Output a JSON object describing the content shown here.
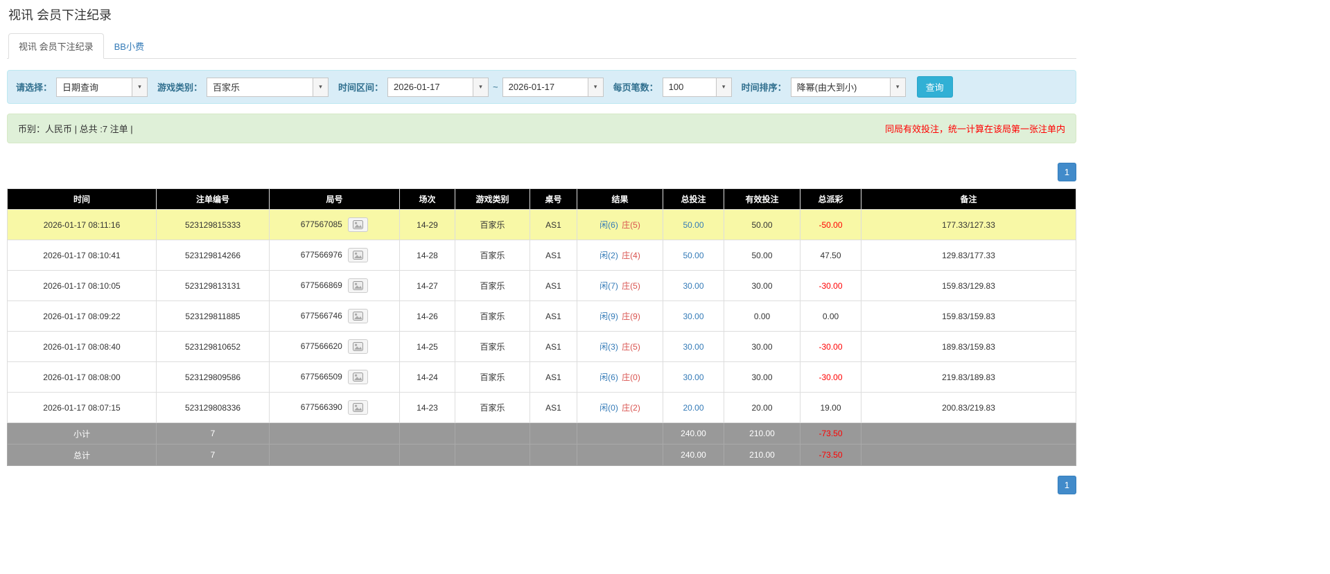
{
  "page": {
    "title": "视讯 会员下注纪录"
  },
  "tabs": [
    {
      "label": "视讯 会员下注纪录"
    },
    {
      "label": "BB小费"
    }
  ],
  "filters": {
    "query_type_label": "请选择：",
    "query_type_value": "日期查询",
    "game_type_label": "游戏类别：",
    "game_type_value": "百家乐",
    "date_range_label": "时间区间：",
    "date_from": "2026-01-17",
    "date_separator": "~",
    "date_to": "2026-01-17",
    "page_size_label": "每页笔数：",
    "page_size_value": "100",
    "sort_label": "时间排序：",
    "sort_value": "降幂(由大到小)",
    "search_button_label": "查询"
  },
  "summary_bar": {
    "info_text": "币别：人民币 | 总共 :7 注单 |",
    "note_text": "同局有效投注，统一计算在该局第一张注单内"
  },
  "pagination": {
    "top_page": "1",
    "bottom_page": "1"
  },
  "table": {
    "headers": [
      "时间",
      "注单编号",
      "局号",
      "场次",
      "游戏类别",
      "桌号",
      "结果",
      "总投注",
      "有效投注",
      "总派彩",
      "备注"
    ],
    "rows": [
      {
        "time": "2026-01-17 08:11:16",
        "bet_id": "523129815333",
        "round_id": "677567085",
        "session": "14-29",
        "game_type": "百家乐",
        "table_no": "AS1",
        "result_player": "闲(6)",
        "result_banker": "庄(5)",
        "total_bet": "50.00",
        "valid_bet": "50.00",
        "payout": "-50.00",
        "note": "177.33/127.33",
        "highlighted": true
      },
      {
        "time": "2026-01-17 08:10:41",
        "bet_id": "523129814266",
        "round_id": "677566976",
        "session": "14-28",
        "game_type": "百家乐",
        "table_no": "AS1",
        "result_player": "闲(2)",
        "result_banker": "庄(4)",
        "total_bet": "50.00",
        "valid_bet": "50.00",
        "payout": "47.50",
        "note": "129.83/177.33",
        "highlighted": false
      },
      {
        "time": "2026-01-17 08:10:05",
        "bet_id": "523129813131",
        "round_id": "677566869",
        "session": "14-27",
        "game_type": "百家乐",
        "table_no": "AS1",
        "result_player": "闲(7)",
        "result_banker": "庄(5)",
        "total_bet": "30.00",
        "valid_bet": "30.00",
        "payout": "-30.00",
        "note": "159.83/129.83",
        "highlighted": false
      },
      {
        "time": "2026-01-17 08:09:22",
        "bet_id": "523129811885",
        "round_id": "677566746",
        "session": "14-26",
        "game_type": "百家乐",
        "table_no": "AS1",
        "result_player": "闲(9)",
        "result_banker": "庄(9)",
        "total_bet": "30.00",
        "valid_bet": "0.00",
        "payout": "0.00",
        "note": "159.83/159.83",
        "highlighted": false
      },
      {
        "time": "2026-01-17 08:08:40",
        "bet_id": "523129810652",
        "round_id": "677566620",
        "session": "14-25",
        "game_type": "百家乐",
        "table_no": "AS1",
        "result_player": "闲(3)",
        "result_banker": "庄(5)",
        "total_bet": "30.00",
        "valid_bet": "30.00",
        "payout": "-30.00",
        "note": "189.83/159.83",
        "highlighted": false
      },
      {
        "time": "2026-01-17 08:08:00",
        "bet_id": "523129809586",
        "round_id": "677566509",
        "session": "14-24",
        "game_type": "百家乐",
        "table_no": "AS1",
        "result_player": "闲(6)",
        "result_banker": "庄(0)",
        "total_bet": "30.00",
        "valid_bet": "30.00",
        "payout": "-30.00",
        "note": "219.83/189.83",
        "highlighted": false
      },
      {
        "time": "2026-01-17 08:07:15",
        "bet_id": "523129808336",
        "round_id": "677566390",
        "session": "14-23",
        "game_type": "百家乐",
        "table_no": "AS1",
        "result_player": "闲(0)",
        "result_banker": "庄(2)",
        "total_bet": "20.00",
        "valid_bet": "20.00",
        "payout": "19.00",
        "note": "200.83/219.83",
        "highlighted": false
      }
    ],
    "subtotal": {
      "label": "小计",
      "count": "7",
      "total_bet": "240.00",
      "valid_bet": "210.00",
      "total_payout": "-73.50"
    },
    "grand_total": {
      "label": "总计",
      "count": "7",
      "total_bet": "240.00",
      "valid_bet": "210.00",
      "total_payout": "-73.50"
    }
  }
}
